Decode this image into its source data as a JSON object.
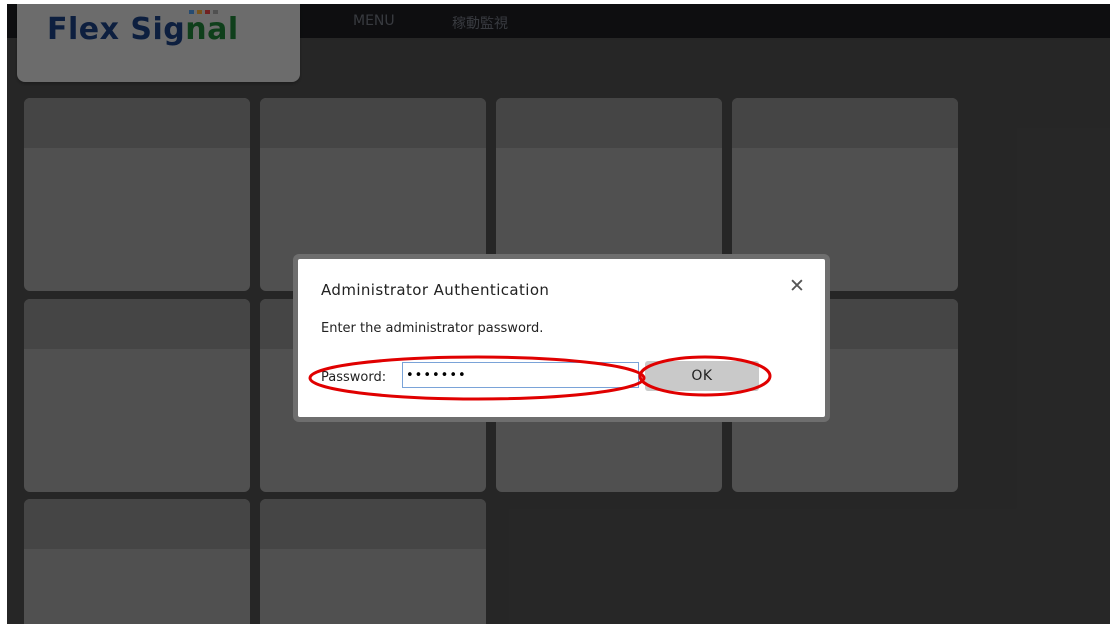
{
  "header": {
    "logo_main": "Flex Sig",
    "logo_accent": "nal",
    "nav": [
      "MENU",
      "稼動監視"
    ]
  },
  "logo_dot_colors": [
    "#4a90d9",
    "#e8a030",
    "#d84040",
    "#9a9a9a"
  ],
  "dialog": {
    "title": "Administrator Authentication",
    "close_symbol": "✕",
    "message": "Enter the administrator password.",
    "password_label": "Password:",
    "password_value": "1234567",
    "ok_label": "OK"
  },
  "colors": {
    "annotation": "#e00000",
    "overlay": "#000000",
    "logo": "#1a3d7a"
  }
}
